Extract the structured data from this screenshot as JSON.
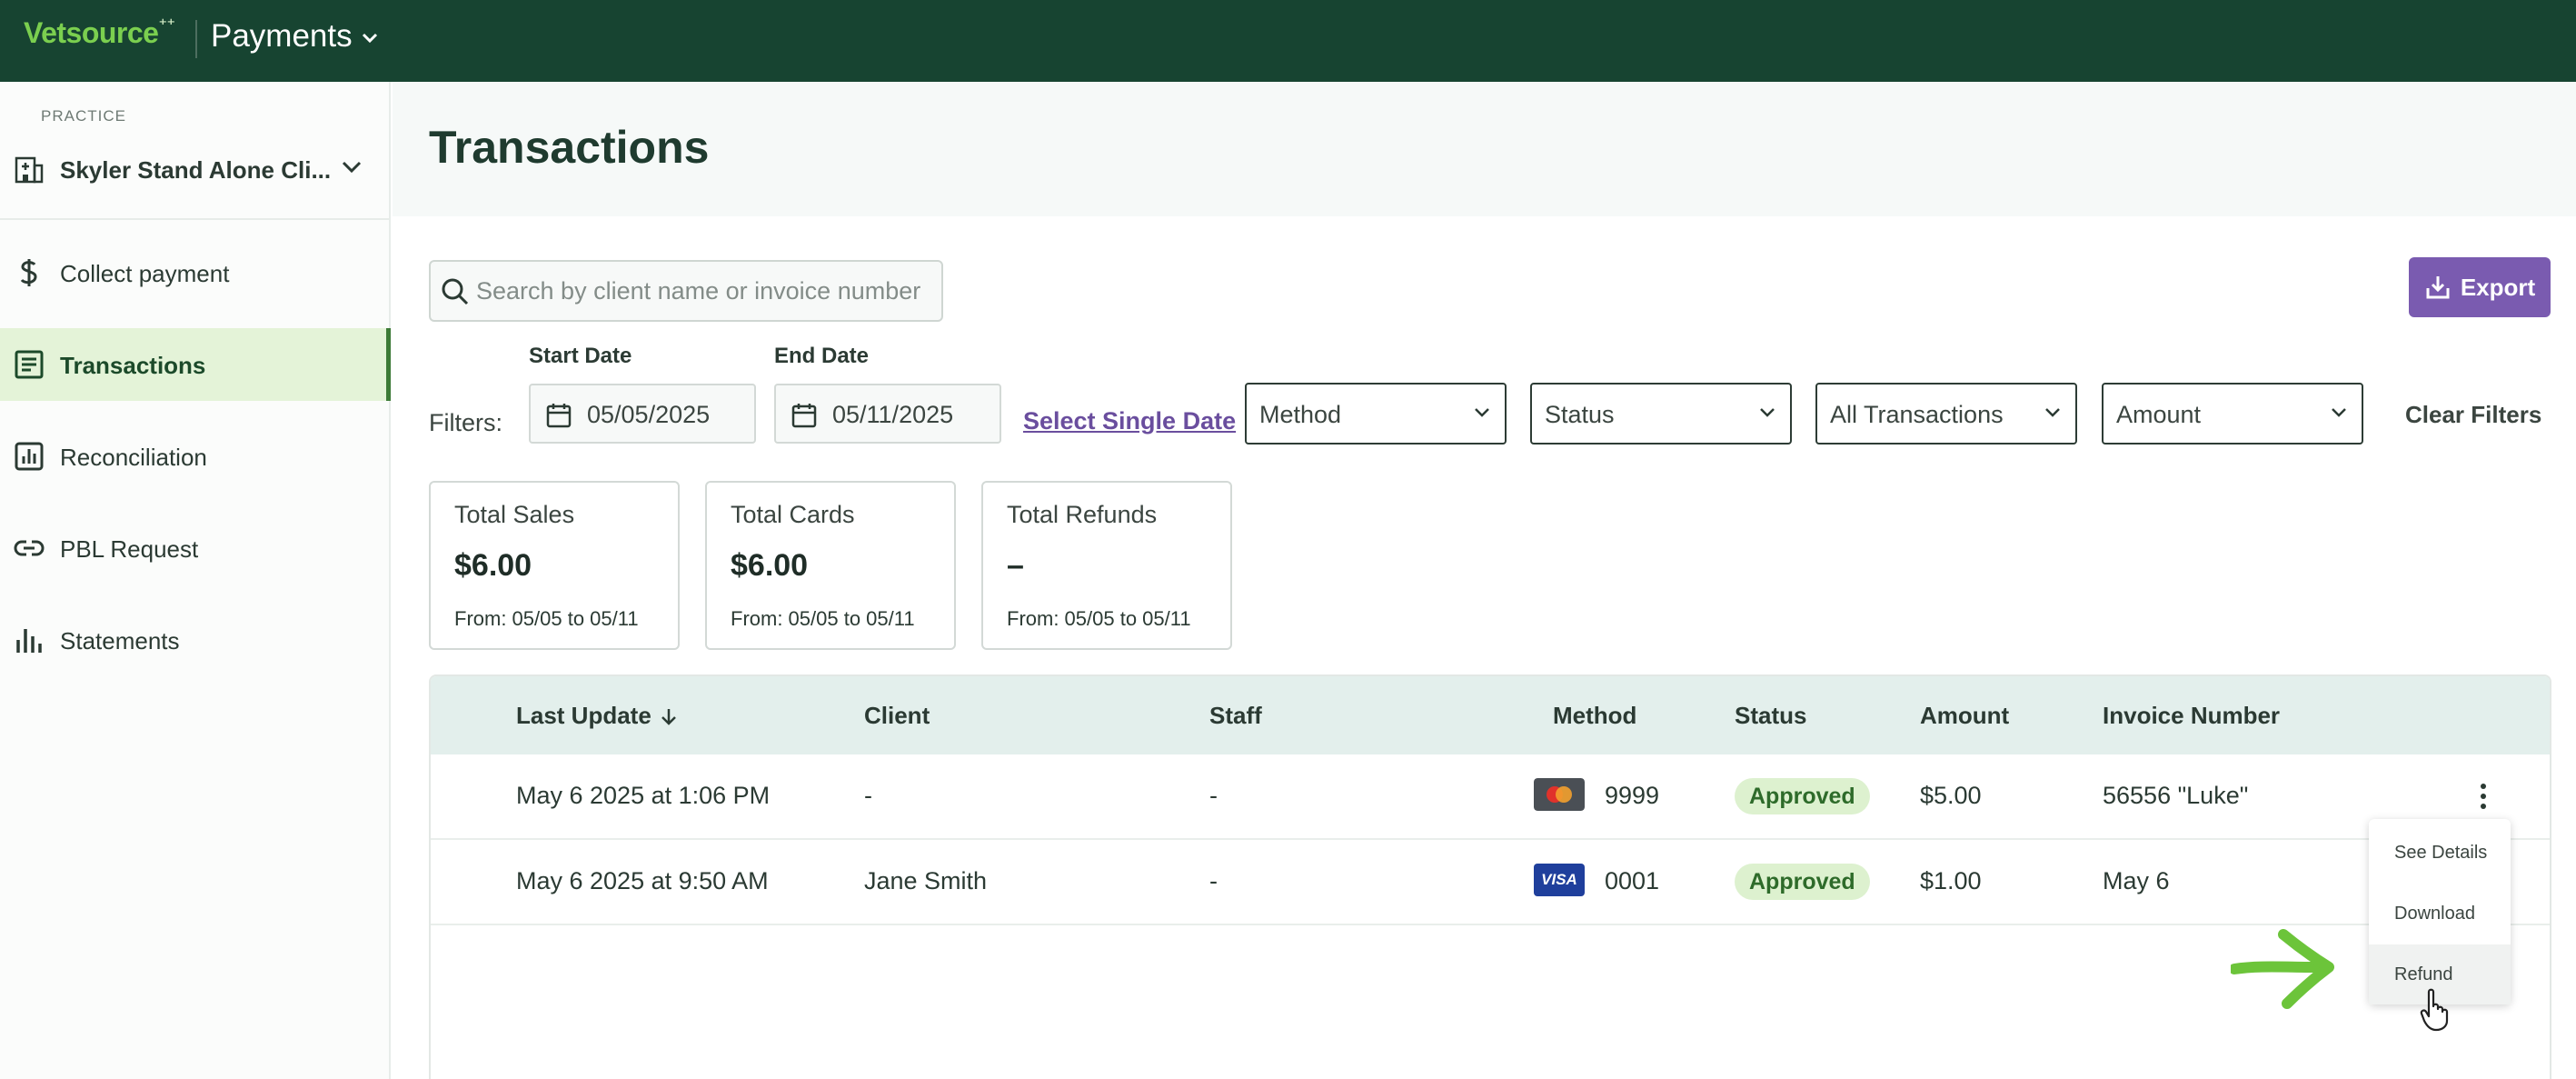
{
  "app": {
    "logo": "Vetsource",
    "name": "Payments"
  },
  "sidebar": {
    "practice_label": "PRACTICE",
    "practice_name": "Skyler Stand Alone Cli...",
    "items": [
      {
        "label": "Collect payment",
        "icon": "dollar-icon"
      },
      {
        "label": "Transactions",
        "icon": "receipt-icon",
        "active": true
      },
      {
        "label": "Reconciliation",
        "icon": "chart-box-icon"
      },
      {
        "label": "PBL Request",
        "icon": "link-icon"
      },
      {
        "label": "Statements",
        "icon": "bar-chart-icon"
      }
    ]
  },
  "page": {
    "title": "Transactions"
  },
  "search": {
    "placeholder": "Search by client name or invoice number",
    "value": ""
  },
  "toolbar": {
    "export_label": "Export"
  },
  "filters": {
    "label": "Filters:",
    "start_date_label": "Start Date",
    "start_date": "05/05/2025",
    "end_date_label": "End Date",
    "end_date": "05/11/2025",
    "single_date_link": "Select Single Date",
    "method": "Method",
    "status": "Status",
    "type": "All Transactions",
    "amount": "Amount",
    "clear": "Clear Filters"
  },
  "summary": [
    {
      "title": "Total Sales",
      "value": "$6.00",
      "range": "From: 05/05 to 05/11"
    },
    {
      "title": "Total Cards",
      "value": "$6.00",
      "range": "From: 05/05 to 05/11"
    },
    {
      "title": "Total Refunds",
      "value": "–",
      "range": "From: 05/05 to 05/11"
    }
  ],
  "table": {
    "columns": [
      "Last Update",
      "Client",
      "Staff",
      "Method",
      "Status",
      "Amount",
      "Invoice Number"
    ],
    "rows": [
      {
        "last_update": "May 6 2025 at 1:06 PM",
        "client": "-",
        "staff": "-",
        "card_brand": "mastercard",
        "last4": "9999",
        "status": "Approved",
        "amount": "$5.00",
        "invoice": "56556 \"Luke\""
      },
      {
        "last_update": "May 6 2025 at 9:50 AM",
        "client": "Jane Smith",
        "staff": "-",
        "card_brand": "visa",
        "card_label": "VISA",
        "last4": "0001",
        "status": "Approved",
        "amount": "$1.00",
        "invoice": "May 6"
      }
    ]
  },
  "row_menu": {
    "items": [
      "See Details",
      "Download",
      "Refund"
    ],
    "hovered": "Refund"
  },
  "colors": {
    "topbar": "#174431",
    "accent_green": "#7bcf4f",
    "export": "#7a5bb0",
    "active_nav": "#e4f3d8",
    "approved_bg": "#ddf1cf"
  }
}
